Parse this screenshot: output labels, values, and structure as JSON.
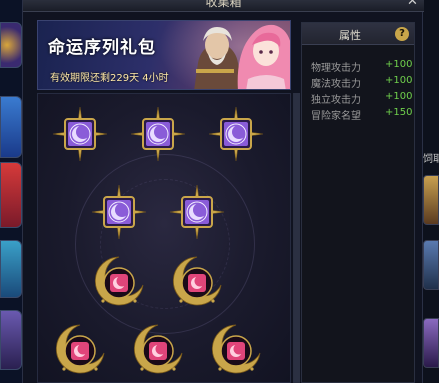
{
  "window": {
    "title": "收集箱",
    "close_icon": "close-icon"
  },
  "banner": {
    "title": "命运序列礼包",
    "expiry": "有效期限还剩229天 4小时"
  },
  "grid": {
    "items": [
      {
        "type": "star-purple",
        "icon": "purple-moon-emblem-icon"
      },
      {
        "type": "star-purple",
        "icon": "purple-moon-emblem-icon"
      },
      {
        "type": "star-purple",
        "icon": "purple-moon-emblem-icon"
      },
      {
        "type": "star-purple",
        "icon": "purple-moon-emblem-icon"
      },
      {
        "type": "star-purple",
        "icon": "purple-moon-emblem-icon"
      },
      {
        "type": "moon-pink",
        "icon": "pink-crescent-emblem-icon"
      },
      {
        "type": "moon-pink",
        "icon": "pink-crescent-emblem-icon"
      },
      {
        "type": "moon-pink",
        "icon": "pink-crescent-emblem-icon"
      },
      {
        "type": "moon-pink",
        "icon": "pink-crescent-emblem-icon"
      },
      {
        "type": "moon-pink",
        "icon": "pink-crescent-emblem-icon"
      }
    ]
  },
  "attributes": {
    "header": "属性",
    "help_icon": "?",
    "rows": [
      {
        "name": "物理攻击力",
        "value": "+100"
      },
      {
        "name": "魔法攻击力",
        "value": "+100"
      },
      {
        "name": "独立攻击力",
        "value": "+100"
      },
      {
        "name": "冒险家名望",
        "value": "+150"
      }
    ]
  },
  "side": {
    "right_text": "饲耶"
  },
  "colors": {
    "accent_gold": "#c9a64a",
    "stat_green": "#6fcf4c",
    "purple_emblem": "#8a5cd8",
    "pink_emblem": "#e0457a"
  }
}
